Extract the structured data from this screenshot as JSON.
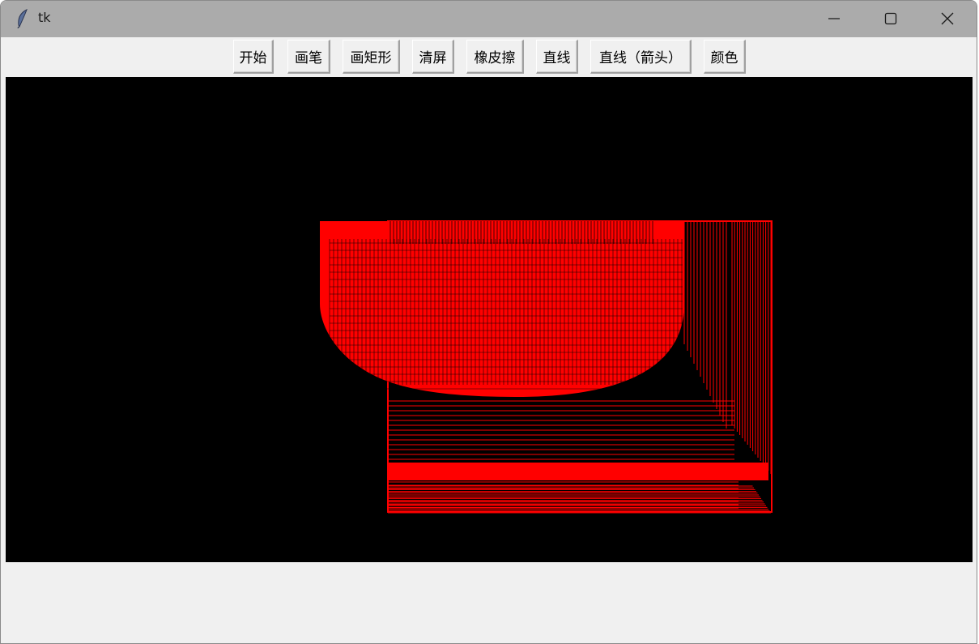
{
  "window": {
    "title": "tk"
  },
  "toolbar": {
    "buttons": [
      {
        "id": "start",
        "label": "开始"
      },
      {
        "id": "pen",
        "label": "画笔"
      },
      {
        "id": "rect",
        "label": "画矩形"
      },
      {
        "id": "clear",
        "label": "清屏"
      },
      {
        "id": "eraser",
        "label": "橡皮擦"
      },
      {
        "id": "line",
        "label": "直线"
      },
      {
        "id": "arrow",
        "label": "直线（箭头）"
      },
      {
        "id": "color",
        "label": "颜色"
      }
    ]
  },
  "canvas": {
    "background": "#000000",
    "stroke_color": "#ff0000"
  },
  "colors": {
    "titlebar": "#ababab",
    "window_bg": "#f0f0f0"
  }
}
